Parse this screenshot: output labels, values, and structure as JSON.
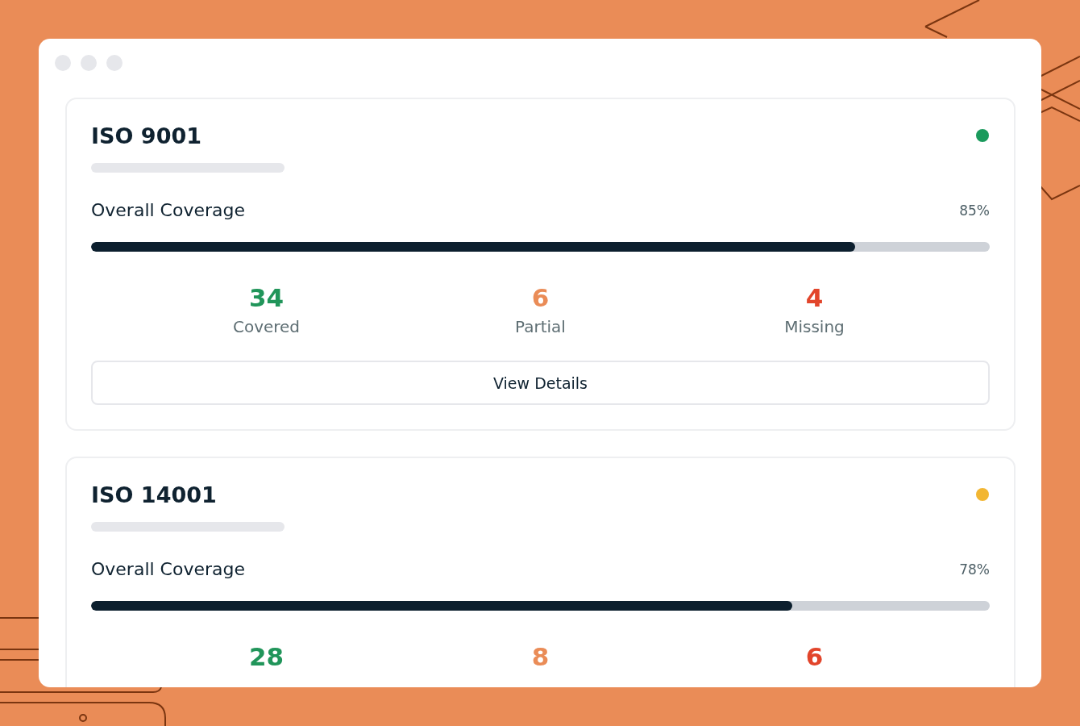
{
  "cards": [
    {
      "title": "ISO 9001",
      "color": "#1a9a5c",
      "coverage_label": "Overall Coverage",
      "coverage_value": "85%",
      "level": 0.85,
      "stats": [
        {
          "value": "34",
          "label": "Covered",
          "color": "#21955a"
        },
        {
          "value": "6",
          "label": "Partial",
          "color": "#ea8c57"
        },
        {
          "value": "4",
          "label": "Missing",
          "color": "#e2452b"
        }
      ],
      "button": "View Details"
    },
    {
      "title": "ISO 14001",
      "color": "#f2b632",
      "coverage_label": "Overall Coverage",
      "coverage_value": "78%",
      "level": 0.78,
      "stats": [
        {
          "value": "28",
          "color": "#21955a"
        },
        {
          "value": "8",
          "color": "#ea8c57"
        },
        {
          "value": "6",
          "color": "#e2452b"
        }
      ]
    }
  ]
}
